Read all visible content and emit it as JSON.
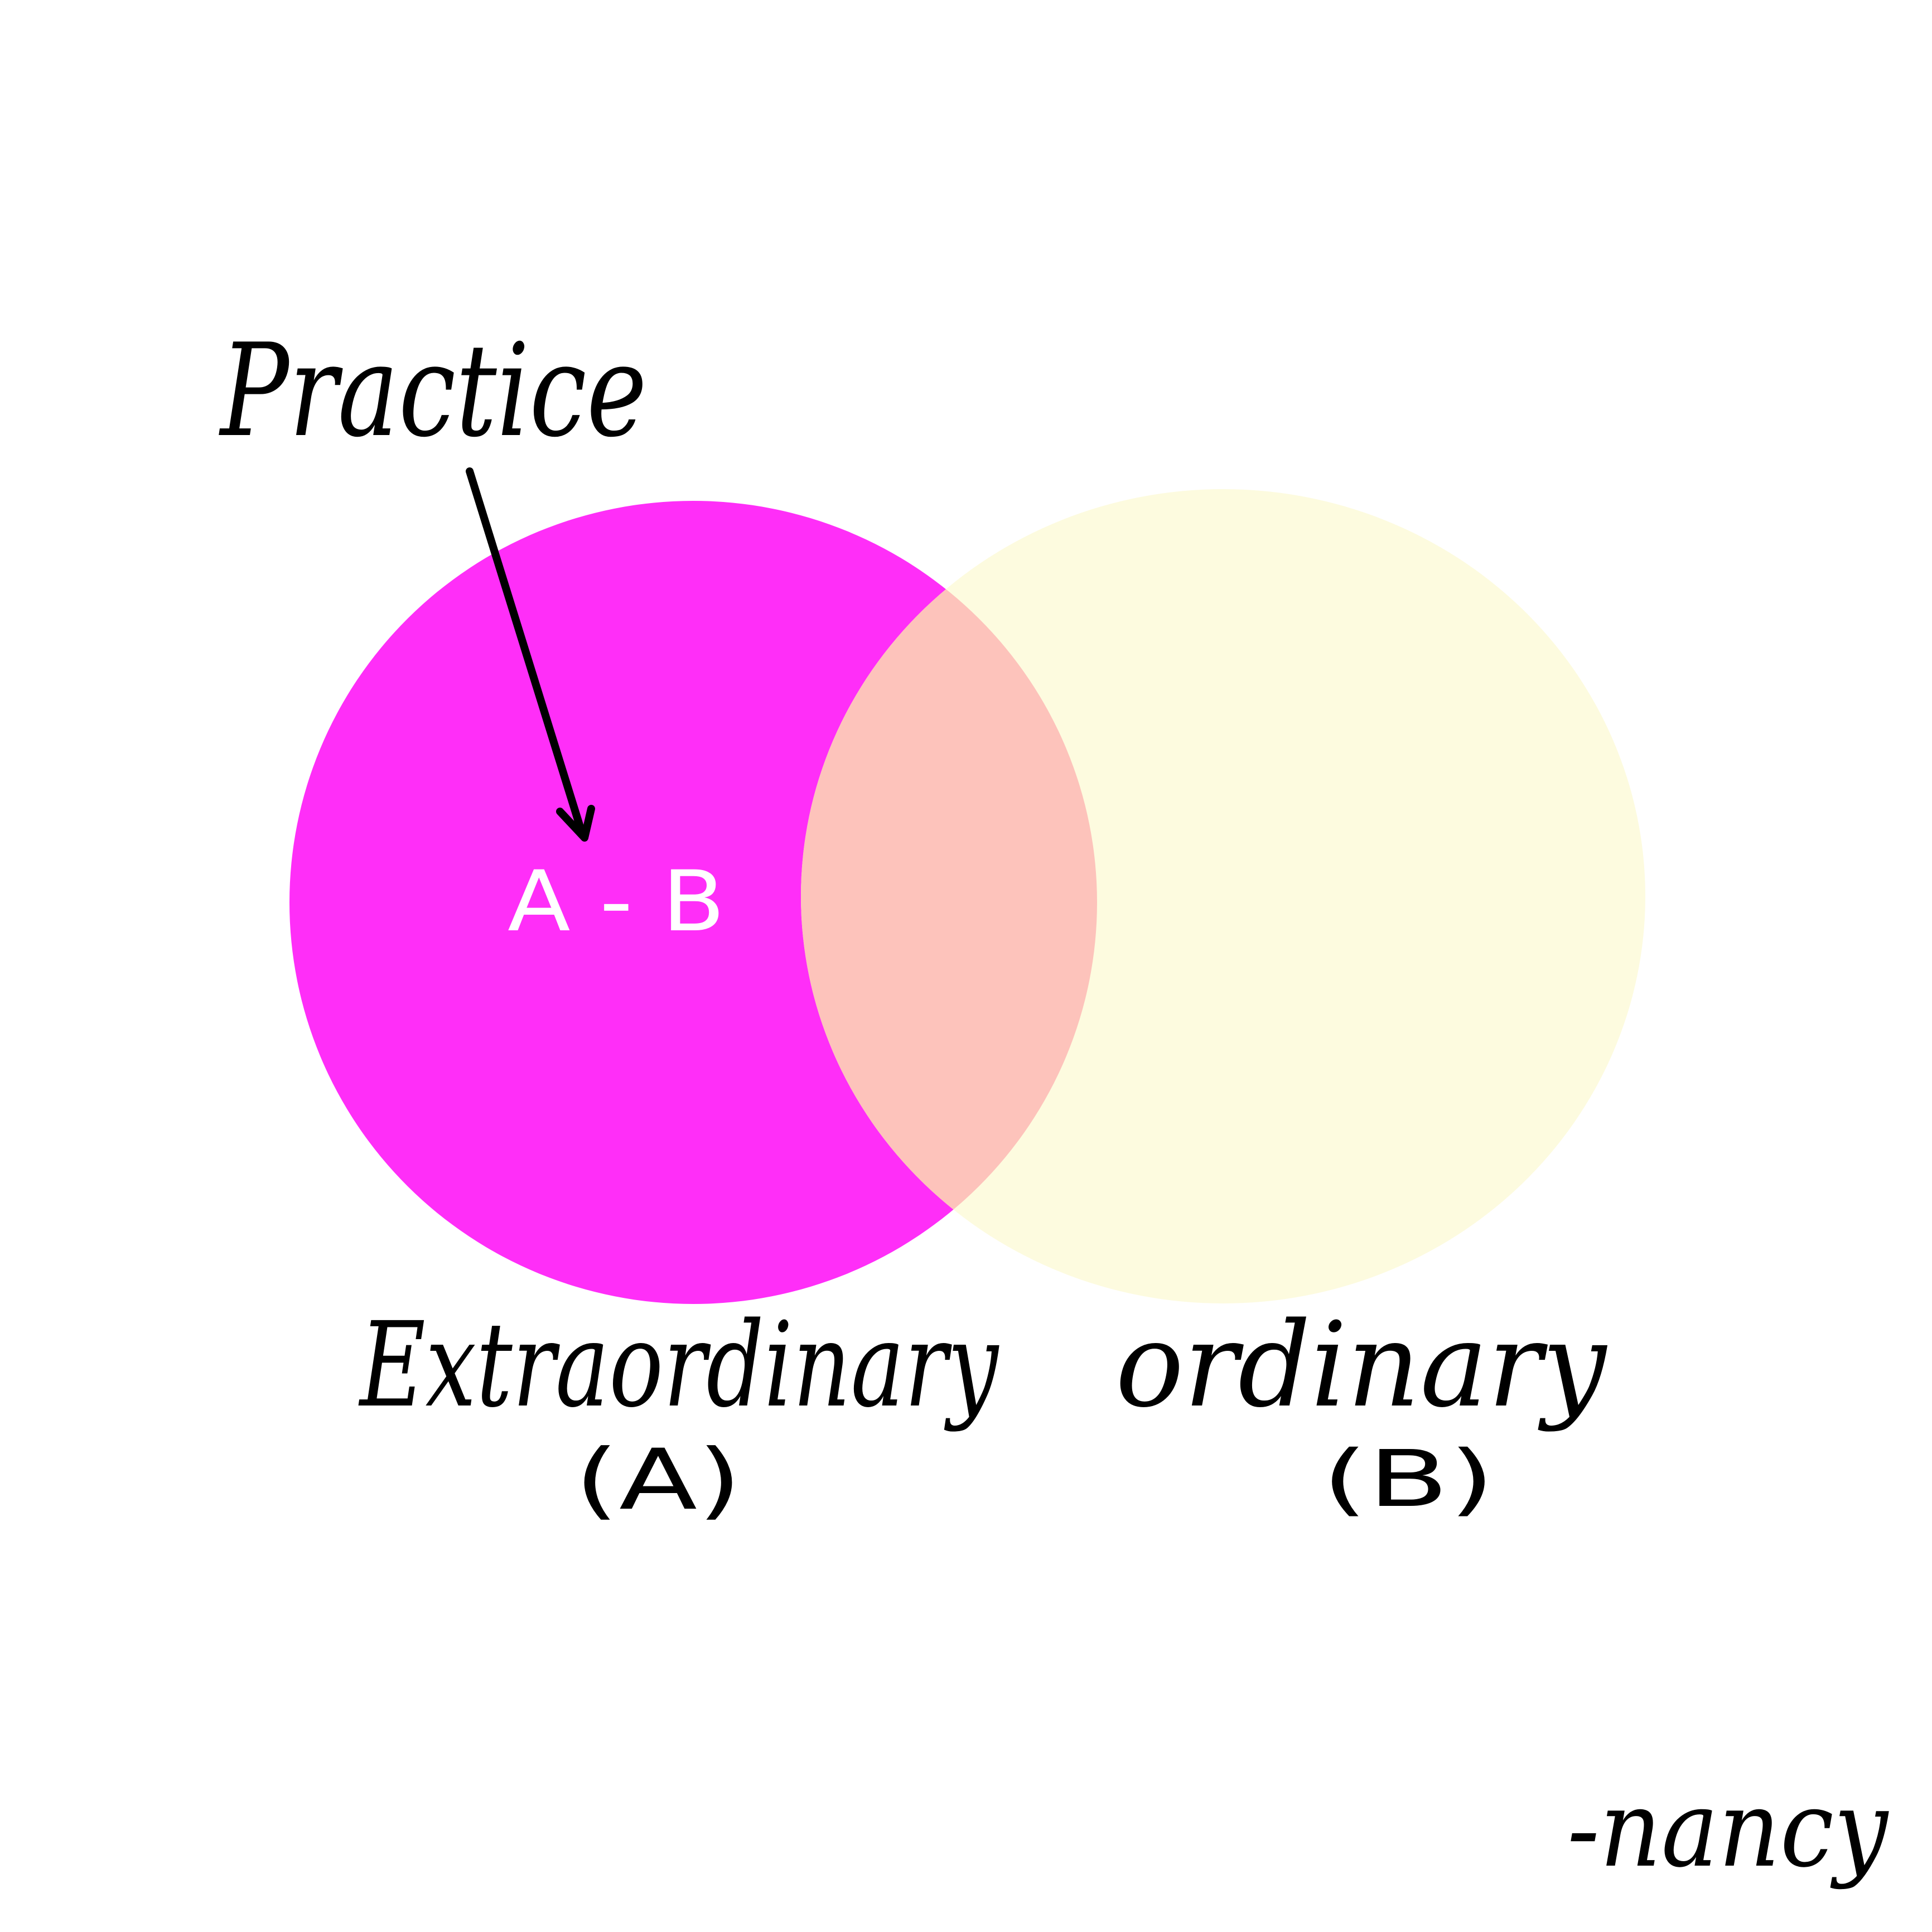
{
  "diagram": {
    "annotation": "Practice",
    "intersection_label": "A - B",
    "set_a": {
      "name": "Extraordinary",
      "symbol": "(A)",
      "color": "#ff2ef8"
    },
    "set_b": {
      "name": "ordinary",
      "symbol": "(B)",
      "color": "#fdfbdf"
    },
    "overlap_color": "#fdc3bb",
    "signature": "-nancy"
  }
}
